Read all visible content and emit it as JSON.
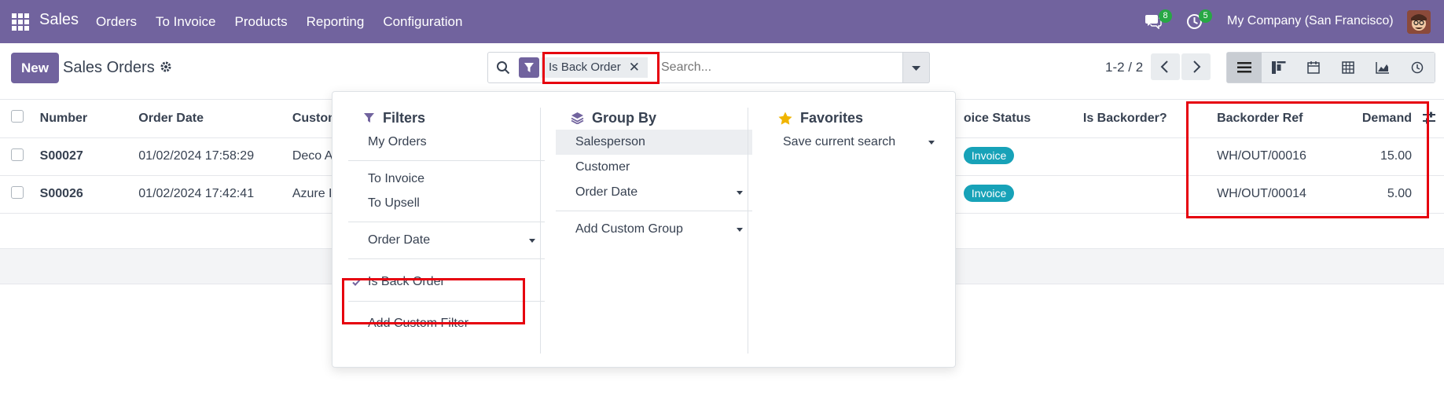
{
  "navbar": {
    "app_name": "Sales",
    "menu": [
      "Orders",
      "To Invoice",
      "Products",
      "Reporting",
      "Configuration"
    ],
    "chat_count": "8",
    "activity_count": "5",
    "company": "My Company (San Francisco)"
  },
  "control": {
    "new_label": "New",
    "title": "Sales Orders",
    "facet_label": "Is Back Order",
    "facet_remove": "✕",
    "search_placeholder": "Search...",
    "pager": "1-2 / 2"
  },
  "table": {
    "headers": [
      "Number",
      "Order Date",
      "Custom",
      "oice Status",
      "Is Backorder?",
      "Backorder Ref",
      "Demand"
    ],
    "rows": [
      {
        "number": "S00027",
        "date": "01/02/2024 17:58:29",
        "customer": "Deco A",
        "status": "Invoice",
        "ref": "WH/OUT/00016",
        "demand": "15.00"
      },
      {
        "number": "S00026",
        "date": "01/02/2024 17:42:41",
        "customer": "Azure I",
        "status": "Invoice",
        "ref": "WH/OUT/00014",
        "demand": "5.00"
      }
    ]
  },
  "dropdown": {
    "filters": {
      "title": "Filters",
      "items": [
        "My Orders",
        "To Invoice",
        "To Upsell",
        "Order Date",
        "Is Back Order",
        "Add Custom Filter"
      ]
    },
    "groupby": {
      "title": "Group By",
      "items": [
        "Salesperson",
        "Customer",
        "Order Date",
        "Add Custom Group"
      ]
    },
    "favorites": {
      "title": "Favorites",
      "items": [
        "Save current search"
      ]
    }
  },
  "colors": {
    "brand": "#71639e",
    "highlight": "#e6000e",
    "status_pill": "#17a2b8",
    "badge": "#28a745"
  }
}
